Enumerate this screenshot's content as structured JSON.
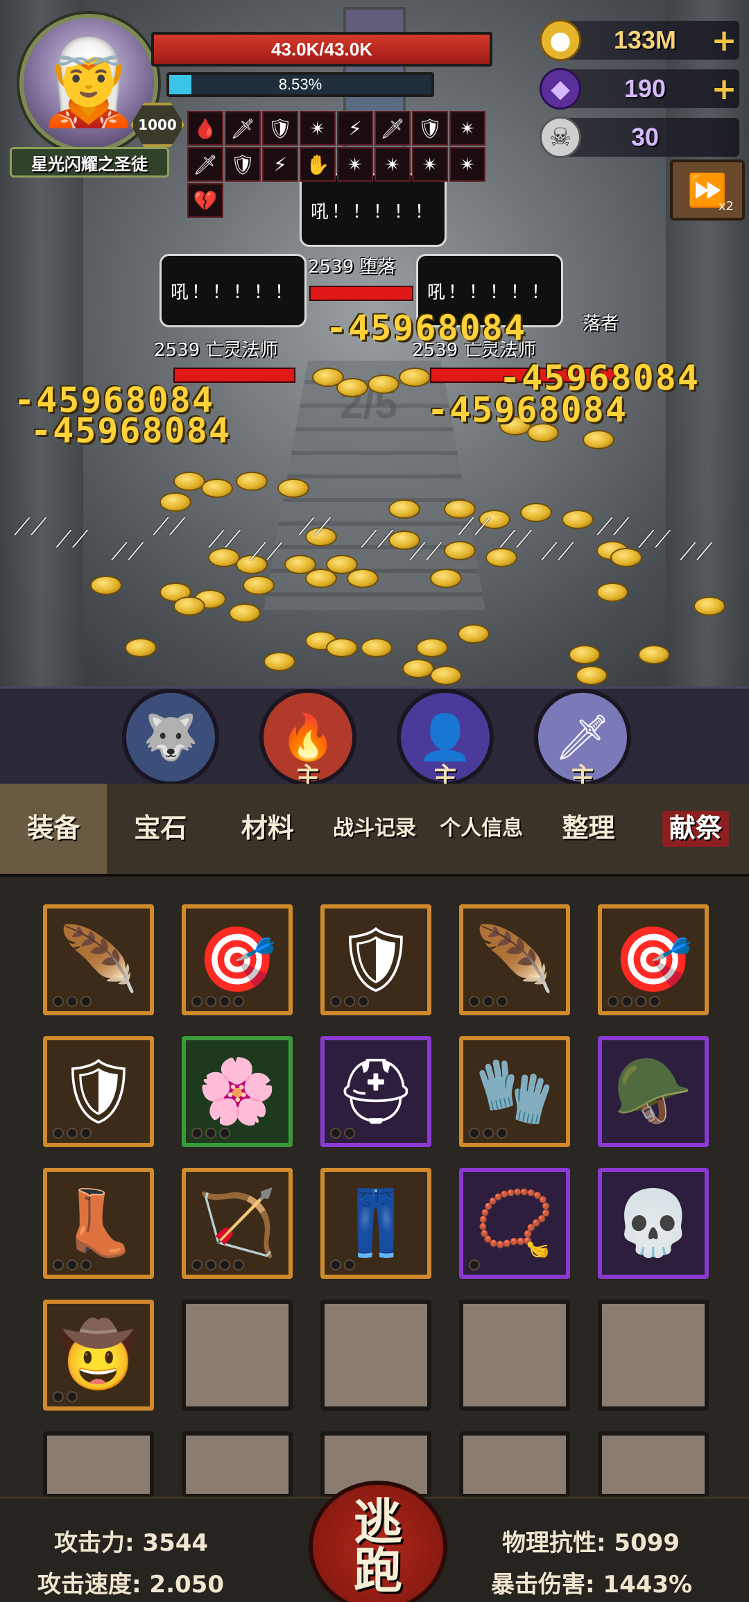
{
  "player": {
    "name": "星光闪耀之圣徒",
    "level": "1000",
    "hp_text": "43.0K/43.0K",
    "xp_text": "8.53%",
    "xp_fraction": 0.0853
  },
  "currency": {
    "gold": "133M",
    "gems": "190",
    "tickets": "30",
    "speed_label": "x2"
  },
  "buffs": [
    "🩸",
    "🗡",
    "🛡",
    "✴",
    "⚡",
    "🗡",
    "🛡",
    "✴",
    "🗡",
    "🛡",
    "⚡",
    "✋",
    "✴",
    "✴",
    "✴",
    "✴",
    "💔"
  ],
  "enemies": [
    {
      "speech": "吼！！！！！",
      "name": "2539 堕落",
      "id": "enemy-top"
    },
    {
      "speech": "吼！！！！！",
      "name": "2539 亡灵法师",
      "id": "enemy-left"
    },
    {
      "speech": "吼！！！！！",
      "name": "2539 亡灵法师",
      "id": "enemy-right"
    }
  ],
  "enemy_extra_label": "落者",
  "damage_numbers": [
    "-45968084",
    "-45968084",
    "-45968084",
    "-45968084",
    "-45968084"
  ],
  "wave": "2/5",
  "skills": [
    {
      "icon": "🐺",
      "main": ""
    },
    {
      "icon": "🔥",
      "main": "主"
    },
    {
      "icon": "👤",
      "main": "主"
    },
    {
      "icon": "🗡",
      "main": "主"
    }
  ],
  "tabs": [
    {
      "label": "装备",
      "name": "tab-equipment"
    },
    {
      "label": "宝石",
      "name": "tab-gems"
    },
    {
      "label": "材料",
      "name": "tab-materials"
    },
    {
      "label": "战斗记录",
      "name": "tab-battle-log"
    },
    {
      "label": "个人信息",
      "name": "tab-profile"
    },
    {
      "label": "整理",
      "name": "tab-sort"
    },
    {
      "label": "献祭",
      "name": "tab-sacrifice"
    }
  ],
  "inventory": [
    {
      "icon": "🪶",
      "rarity": "orange",
      "dots": 3
    },
    {
      "icon": "🎯",
      "rarity": "orange",
      "dots": 4
    },
    {
      "icon": "🛡",
      "rarity": "orange",
      "dots": 3
    },
    {
      "icon": "🪶",
      "rarity": "orange",
      "dots": 3
    },
    {
      "icon": "🎯",
      "rarity": "orange",
      "dots": 4
    },
    {
      "icon": "🛡",
      "rarity": "orange",
      "dots": 3
    },
    {
      "icon": "🌸",
      "rarity": "green",
      "dots": 3
    },
    {
      "icon": "⛑",
      "rarity": "purple",
      "dots": 2
    },
    {
      "icon": "🧤",
      "rarity": "orange",
      "dots": 3
    },
    {
      "icon": "🪖",
      "rarity": "purple",
      "dots": 0
    },
    {
      "icon": "👢",
      "rarity": "orange",
      "dots": 3
    },
    {
      "icon": "🏹",
      "rarity": "orange",
      "dots": 4
    },
    {
      "icon": "👖",
      "rarity": "orange",
      "dots": 2
    },
    {
      "icon": "📿",
      "rarity": "purple",
      "dots": 1
    },
    {
      "icon": "💀",
      "rarity": "purple",
      "dots": 0
    },
    {
      "icon": "🤠",
      "rarity": "orange",
      "dots": 2
    },
    {
      "icon": "",
      "rarity": "empty",
      "dots": 0
    },
    {
      "icon": "",
      "rarity": "empty",
      "dots": 0
    },
    {
      "icon": "",
      "rarity": "empty",
      "dots": 0
    },
    {
      "icon": "",
      "rarity": "empty",
      "dots": 0
    },
    {
      "icon": "",
      "rarity": "empty",
      "dots": 0
    },
    {
      "icon": "",
      "rarity": "empty",
      "dots": 0
    },
    {
      "icon": "",
      "rarity": "empty",
      "dots": 0
    },
    {
      "icon": "",
      "rarity": "empty",
      "dots": 0
    },
    {
      "icon": "",
      "rarity": "empty",
      "dots": 0
    }
  ],
  "stats": {
    "attack": "攻击力: 3544",
    "attack_speed": "攻击速度: 2.050",
    "phys_res": "物理抗性: 5099",
    "crit_dmg": "暴击伤害: 1443%",
    "flee_top": "逃",
    "flee_bottom": "跑"
  }
}
